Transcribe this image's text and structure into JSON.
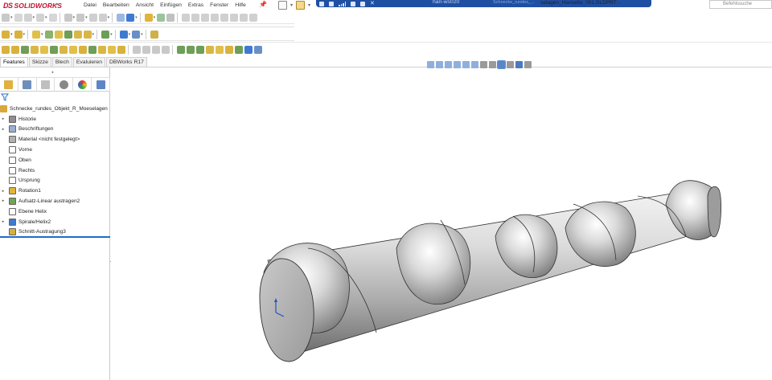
{
  "app": {
    "logo_ds": "DS",
    "logo_name": "SOLIDWORKS"
  },
  "menu": {
    "items": [
      "Datei",
      "Bearbeiten",
      "Ansicht",
      "Einfügen",
      "Extras",
      "Fenster",
      "Hilfe"
    ]
  },
  "remote_band": {
    "host": "han-ws020",
    "doc_partial": "Schnecke_rundes_..."
  },
  "document": {
    "title": "selagen_Hansella_001.SLDPRT",
    "title_caret": "▾"
  },
  "command_search": {
    "placeholder": "Befehlssuche"
  },
  "tabs": [
    "Features",
    "Skizze",
    "Blech",
    "Evaluieren",
    "DBWorks R17"
  ],
  "active_tab": "Features",
  "feature_tree": {
    "root": "Schnecke_rundes_Objekt_R_Moeselagen",
    "nodes": [
      {
        "label": "Historie",
        "expandable": true,
        "icon": "history-icon"
      },
      {
        "label": "Beschriftungen",
        "expandable": true,
        "icon": "annotations-icon"
      },
      {
        "label": "Material <nicht festgelegt>",
        "expandable": false,
        "icon": "material-icon"
      },
      {
        "label": "Vorne",
        "expandable": false,
        "icon": "plane-icon"
      },
      {
        "label": "Oben",
        "expandable": false,
        "icon": "plane-icon"
      },
      {
        "label": "Rechts",
        "expandable": false,
        "icon": "plane-icon"
      },
      {
        "label": "Ursprung",
        "expandable": false,
        "icon": "origin-icon"
      },
      {
        "label": "Rotation1",
        "expandable": true,
        "icon": "revolve-icon"
      },
      {
        "label": "Aufsatz-Linear austragen2",
        "expandable": true,
        "icon": "extrude-icon"
      },
      {
        "label": "Ebene Helix",
        "expandable": false,
        "icon": "plane-icon"
      },
      {
        "label": "Spirale/Helix2",
        "expandable": true,
        "icon": "helix-icon"
      },
      {
        "label": "Schnitt-Austragung3",
        "expandable": false,
        "icon": "swept-cut-icon"
      }
    ]
  },
  "colors": {
    "brand_red": "#c8102e",
    "remote_band_blue": "#1f4fa3",
    "rollback_blue": "#1c6dd0",
    "model_gray": "#a8a8a8"
  }
}
